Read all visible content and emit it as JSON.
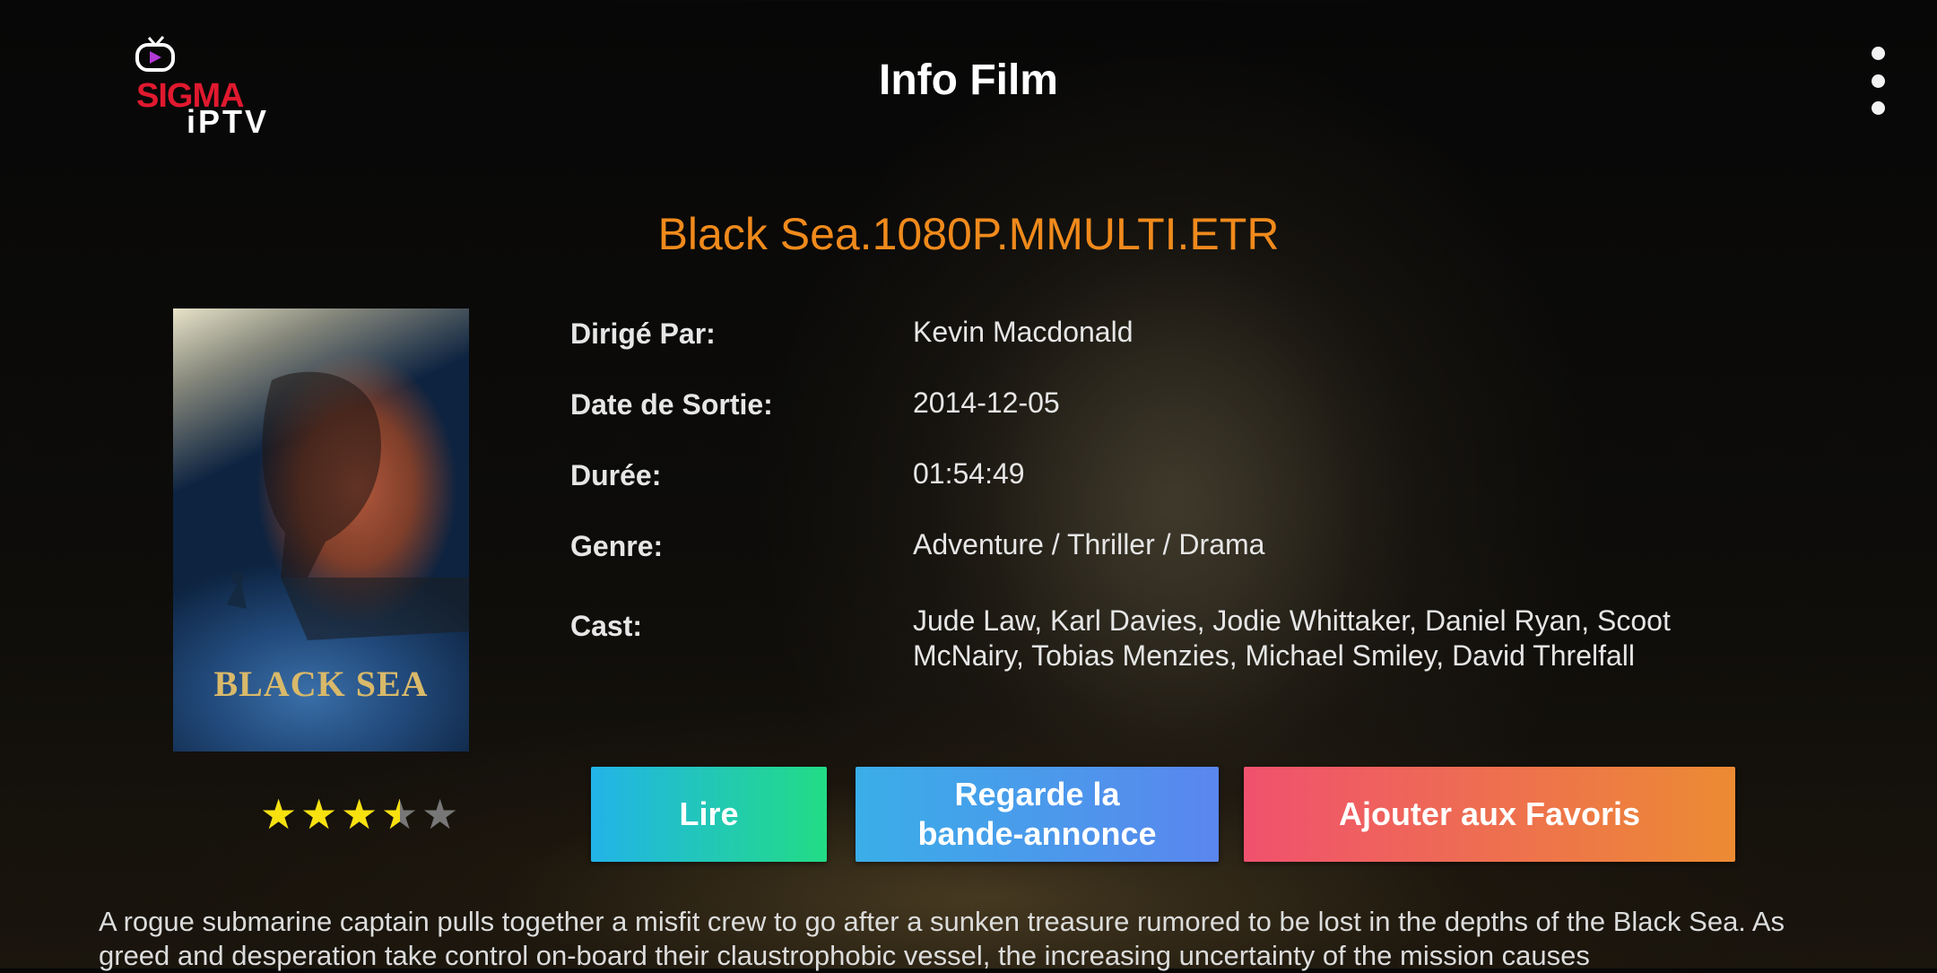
{
  "header": {
    "logo_text_primary": "SIGMA",
    "logo_text_secondary": "iPTV",
    "title": "Info Film",
    "menu_icon": "more-vertical-icon"
  },
  "movie": {
    "title": "Black Sea.1080P.MMULTI.ETR",
    "poster_text": "BLACK SEA",
    "rating": 3.5,
    "rating_max": 5,
    "details": [
      {
        "label": "Dirigé Par:",
        "value": "Kevin Macdonald"
      },
      {
        "label": "Date de Sortie:",
        "value": "2014-12-05"
      },
      {
        "label": "Durée:",
        "value": "01:54:49"
      },
      {
        "label": "Genre:",
        "value": "Adventure / Thriller / Drama"
      },
      {
        "label": "Cast:",
        "value": "Jude Law, Karl Davies, Jodie Whittaker, Daniel Ryan, Scoot McNairy, Tobias Menzies, Michael Smiley, David Threlfall"
      }
    ],
    "plot": "A rogue submarine captain pulls together a misfit crew to go after a sunken treasure rumored to be lost in the depths of the Black Sea. As greed and desperation take control on-board their claustrophobic vessel, the increasing uncertainty of the mission causes"
  },
  "buttons": {
    "play": "Lire",
    "trailer": "Regarde la bande-annonce",
    "favorite": "Ajouter aux Favoris"
  },
  "colors": {
    "accent_title": "#f08a1c",
    "star_filled": "#f7e10f",
    "star_empty": "#777777",
    "brand_red": "#e0192f"
  }
}
